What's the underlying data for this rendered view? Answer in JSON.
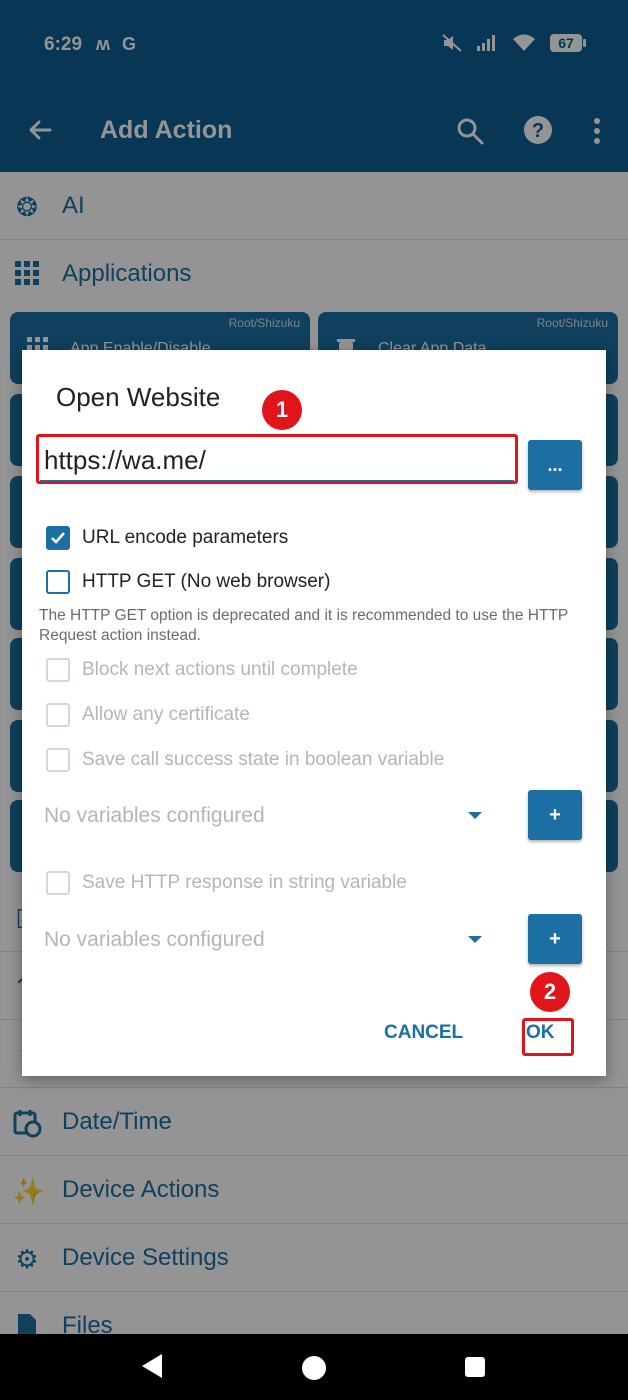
{
  "status": {
    "time": "6:29",
    "battery": "67"
  },
  "app_bar": {
    "title": "Add Action"
  },
  "categories": {
    "ai": "AI",
    "applications": "Applications",
    "date_time": "Date/Time",
    "device_actions": "Device Actions",
    "device_settings": "Device Settings",
    "files": "Files"
  },
  "tiles": {
    "app_enable": {
      "label": "App Enable/Disable",
      "tag": "Root/Shizuku"
    },
    "clear_app_data": {
      "label": "Clear App Data",
      "tag": "Root/Shizuku"
    }
  },
  "dialog": {
    "title": "Open Website",
    "url_value": "https://wa.me/",
    "ellipsis_label": "...",
    "options": {
      "url_encode": "URL encode parameters",
      "http_get": "HTTP GET (No web browser)",
      "block_next": "Block next actions until complete",
      "allow_cert": "Allow any certificate",
      "save_success": "Save call success state in boolean variable",
      "save_response": "Save HTTP response in string variable"
    },
    "note": "The HTTP GET option is deprecated and it is recommended to use the HTTP Request action instead.",
    "var_placeholder_1": "No variables configured",
    "var_placeholder_2": "No variables configured",
    "plus_label": "+",
    "cancel_label": "CANCEL",
    "ok_label": "OK"
  },
  "callouts": {
    "first": "1",
    "second": "2"
  },
  "colors": {
    "primary": "#0d5f93",
    "accent": "#1b6fa3",
    "highlight": "#e0141a"
  }
}
